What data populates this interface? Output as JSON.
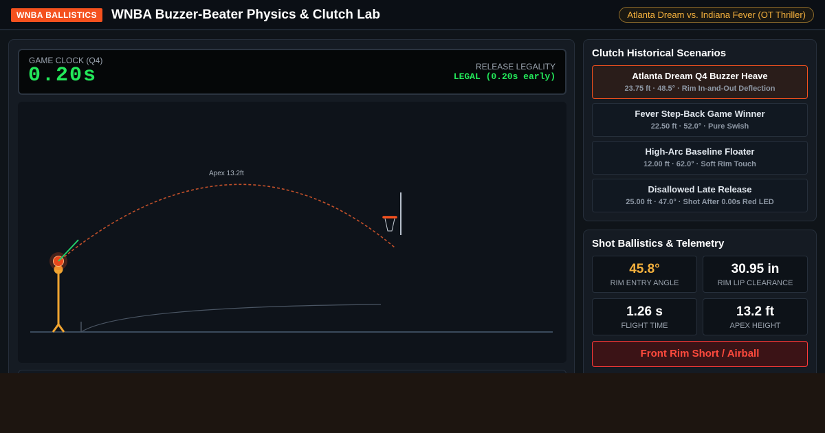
{
  "header": {
    "brand": "WNBA BALLISTICS",
    "title": "WNBA Buzzer-Beater Physics & Clutch Lab",
    "matchup": "Atlanta Dream vs. Indiana Fever (OT Thriller)"
  },
  "clock": {
    "label": "GAME CLOCK (Q4)",
    "value": "0.20s",
    "legality_label": "RELEASE LEGALITY",
    "legality_value": "LEGAL (0.20s early)"
  },
  "court": {
    "apex_label": "Apex 13.2ft"
  },
  "scenarios": {
    "title": "Clutch Historical Scenarios",
    "items": [
      {
        "name": "Atlanta Dream Q4 Buzzer Heave",
        "meta": "23.75 ft · 48.5° · Rim In-and-Out Deflection",
        "active": true
      },
      {
        "name": "Fever Step-Back Game Winner",
        "meta": "22.50 ft · 52.0° · Pure Swish",
        "active": false
      },
      {
        "name": "High-Arc Baseline Floater",
        "meta": "12.00 ft · 62.0° · Soft Rim Touch",
        "active": false
      },
      {
        "name": "Disallowed Late Release",
        "meta": "25.00 ft · 47.0° · Shot After 0.00s Red LED",
        "active": false
      }
    ]
  },
  "telemetry": {
    "title": "Shot Ballistics & Telemetry",
    "metrics": [
      {
        "value": "45.8°",
        "label": "RIM ENTRY ANGLE"
      },
      {
        "value": "30.95 in",
        "label": "RIM LIP CLEARANCE"
      },
      {
        "value": "1.26 s",
        "label": "FLIGHT TIME"
      },
      {
        "value": "13.2 ft",
        "label": "APEX HEIGHT"
      }
    ],
    "result": "Front Rim Short / Airball"
  },
  "colors": {
    "brand": "#f4511e",
    "clock_green": "#23e85a",
    "accent_amber": "#f5b13d",
    "alert_red": "#ff4a3d"
  }
}
